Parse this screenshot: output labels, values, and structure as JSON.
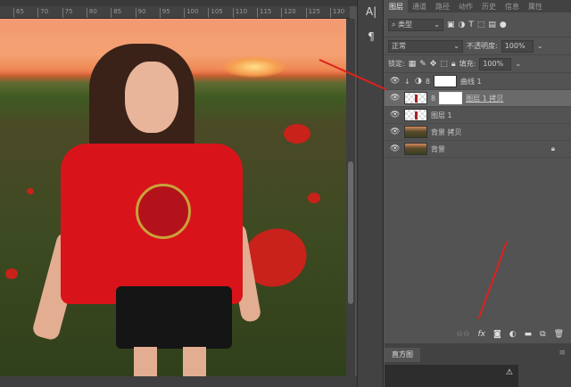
{
  "ruler": {
    "ticks": [
      "65",
      "70",
      "75",
      "80",
      "85",
      "90",
      "95",
      "100",
      "105",
      "110",
      "115",
      "120",
      "125",
      "130"
    ]
  },
  "toolstrip": {
    "type_tool": "A|",
    "paragraph_tool": "¶"
  },
  "panel": {
    "tabs": [
      "图层",
      "通道",
      "路径",
      "动作",
      "历史",
      "信息",
      "属性"
    ],
    "filter": {
      "label": "⌕ 类型"
    },
    "blend_mode": "正常",
    "opacity_label": "不透明度:",
    "opacity": "100%",
    "lock_label": "锁定:",
    "fill_label": "填充:",
    "fill": "100%",
    "layers": [
      {
        "name": "曲线 1",
        "type": "adjustment",
        "active": false
      },
      {
        "name": "图层 1 拷贝",
        "type": "masked",
        "active": true
      },
      {
        "name": "图层 1",
        "type": "pixel",
        "active": false
      },
      {
        "name": "背景 拷贝",
        "type": "bg",
        "active": false
      },
      {
        "name": "背景",
        "type": "bg",
        "active": false,
        "locked": true
      }
    ],
    "bottom_icons": [
      "link-icon",
      "fx-icon",
      "add-mask-icon",
      "adjustment-icon",
      "folder-icon",
      "new-layer-icon",
      "trash-icon"
    ]
  },
  "histogram": {
    "tab": "直方图",
    "warning": "⚠"
  },
  "colors": {
    "arrow": "#e0201a",
    "panel": "#535353"
  }
}
